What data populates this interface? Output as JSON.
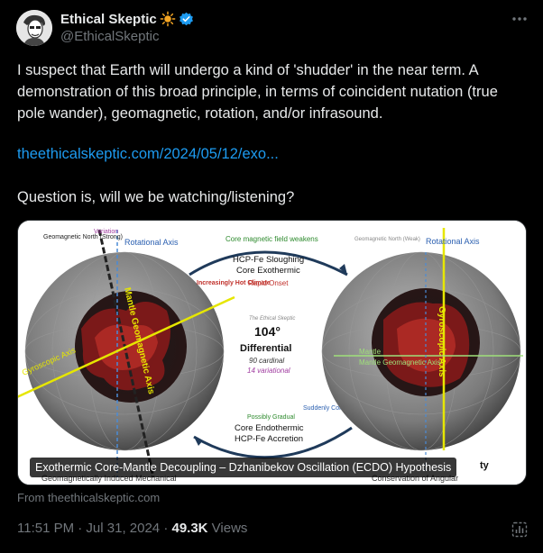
{
  "author": {
    "name": "Ethical Skeptic",
    "handle": "@EthicalSkeptic",
    "emoji_icon": "sun-icon",
    "verified_icon": "verified-badge-icon"
  },
  "tweet": {
    "text": "I suspect that Earth will undergo a kind of 'shudder' in the near term. A demonstration of this broad principle, in terms of coincident nutation (true pole wander), geomagnetic, rotation, and/or infrasound.",
    "link_text": "theethicalskeptic.com/2024/05/12/exo...",
    "question": "Question is, will we be watching/listening?"
  },
  "media": {
    "caption": "Exothermic Core-Mantle Decoupling – Dzhanibekov Oscillation (ECDO) Hypothesis",
    "source": "From theethicalskeptic.com",
    "diagram": {
      "left_geo_north": "Geomagnetic North (Strong)",
      "variation": "Variation",
      "left_rot_axis": "Rotational Axis",
      "core_weakens": "Core magnetic field weakens",
      "top_arc_line1": "HCP-Fe Sloughing",
      "top_arc_line2": "Core Exothermic",
      "hot_climate": "Increasingly Hot Climate",
      "rapid_onset": "Rapid Onset",
      "right_geo_north": "Geomagnetic North (Weak)",
      "right_rot_axis": "Rotational Axis",
      "watermark": "The Ethical Skeptic",
      "angle": "104°",
      "differential": "Differential",
      "cardinal": "90 cardinal",
      "variational": "14 variational",
      "mantle_axis": "Mantle Geomagnetic Axis",
      "gyro_axis_left": "Gyroscopic Axis",
      "gyro_axis_right": "Gyroscopic Axis",
      "right_mantle": "Mantle Geomagnetic Axis",
      "possibly_gradual": "Possibly Gradual",
      "cold_climate": "Suddenly Cold Climate",
      "bottom_arc_line1": "Core Endothermic",
      "bottom_arc_line2": "HCP-Fe Accretion",
      "bottom_left": "Geomagnetically Induced Mechanical",
      "bottom_right": "Conservation of Angular",
      "partial_right": "ty"
    }
  },
  "meta": {
    "time": "11:51 PM · Jul 31, 2024 · ",
    "views_count": "49.3K",
    "views_label": " Views"
  },
  "colors": {
    "background": "#000000",
    "text": "#e7e9ea",
    "secondary": "#71767b",
    "link": "#1d9bf0"
  }
}
